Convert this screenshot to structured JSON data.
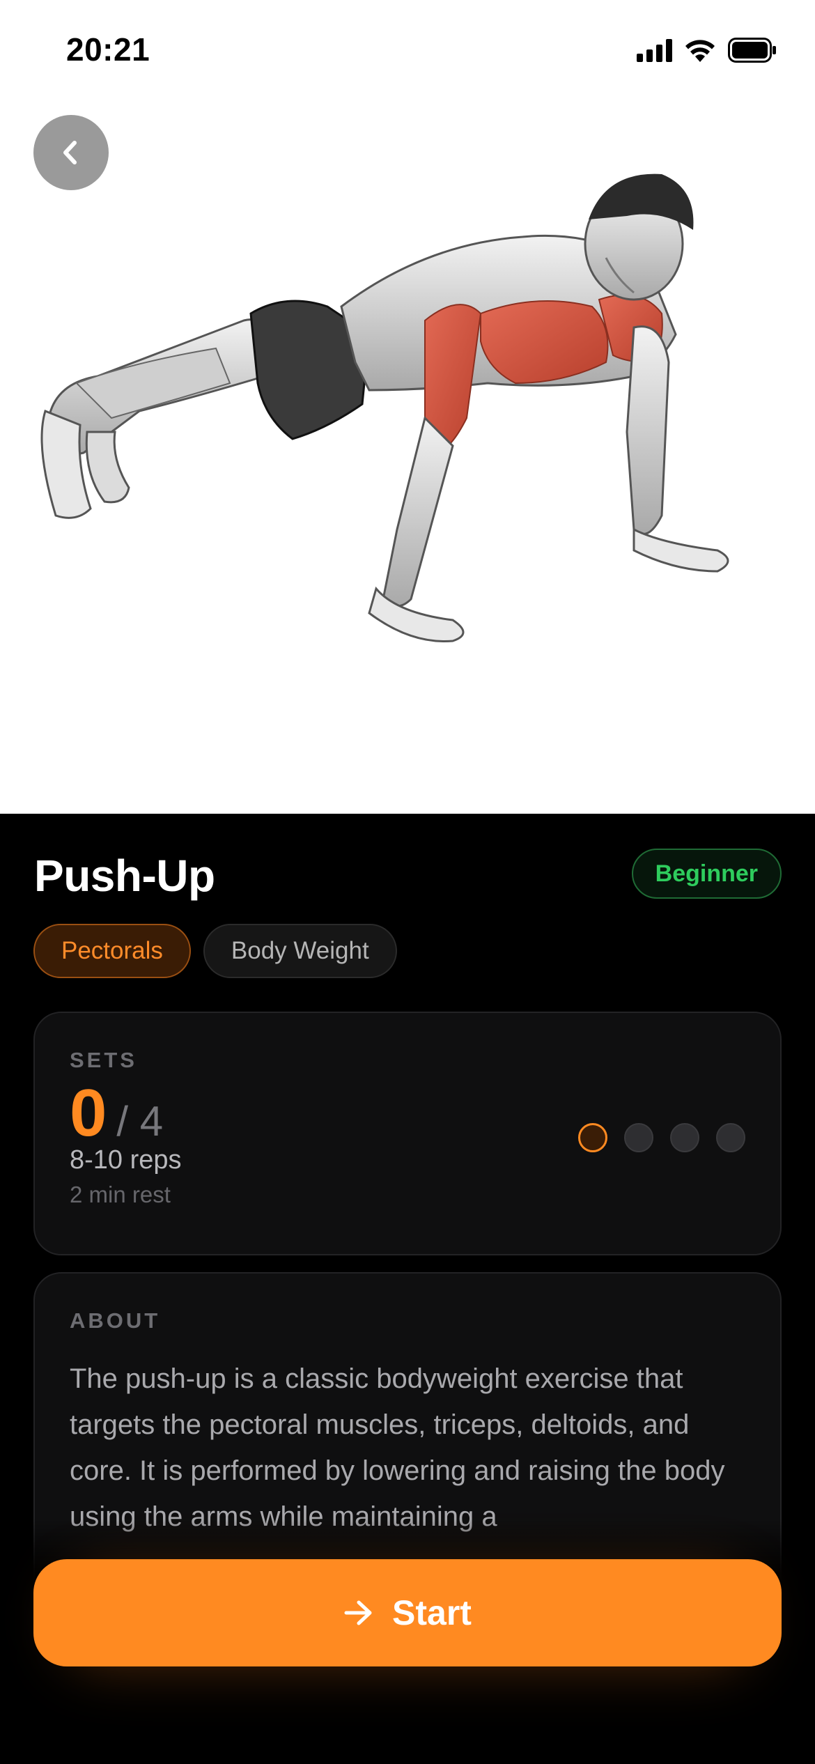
{
  "status_bar": {
    "time": "20:21"
  },
  "exercise": {
    "name": "Push-Up",
    "level": "Beginner",
    "tags": [
      "Pectorals",
      "Body Weight"
    ],
    "illustration_icon": "push-up-illustration"
  },
  "sets": {
    "label": "SETS",
    "completed": "0",
    "total": "/ 4",
    "reps": "8-10 reps",
    "rest": "2 min rest",
    "dots_count": 4,
    "current_index": 0
  },
  "about": {
    "label": "ABOUT",
    "text": "The push-up is a classic bodyweight exercise that targets the pectoral muscles, triceps, deltoids, and core. It is performed by lowering and raising the body using the arms while maintaining a"
  },
  "actions": {
    "start_label": "Start",
    "back_icon": "chevron-left-icon"
  },
  "colors": {
    "accent": "#ff8a21",
    "level_green": "#2ecc5d",
    "background": "#000000",
    "card": "#0f0f10",
    "muscle_highlight": "#d8553f"
  }
}
